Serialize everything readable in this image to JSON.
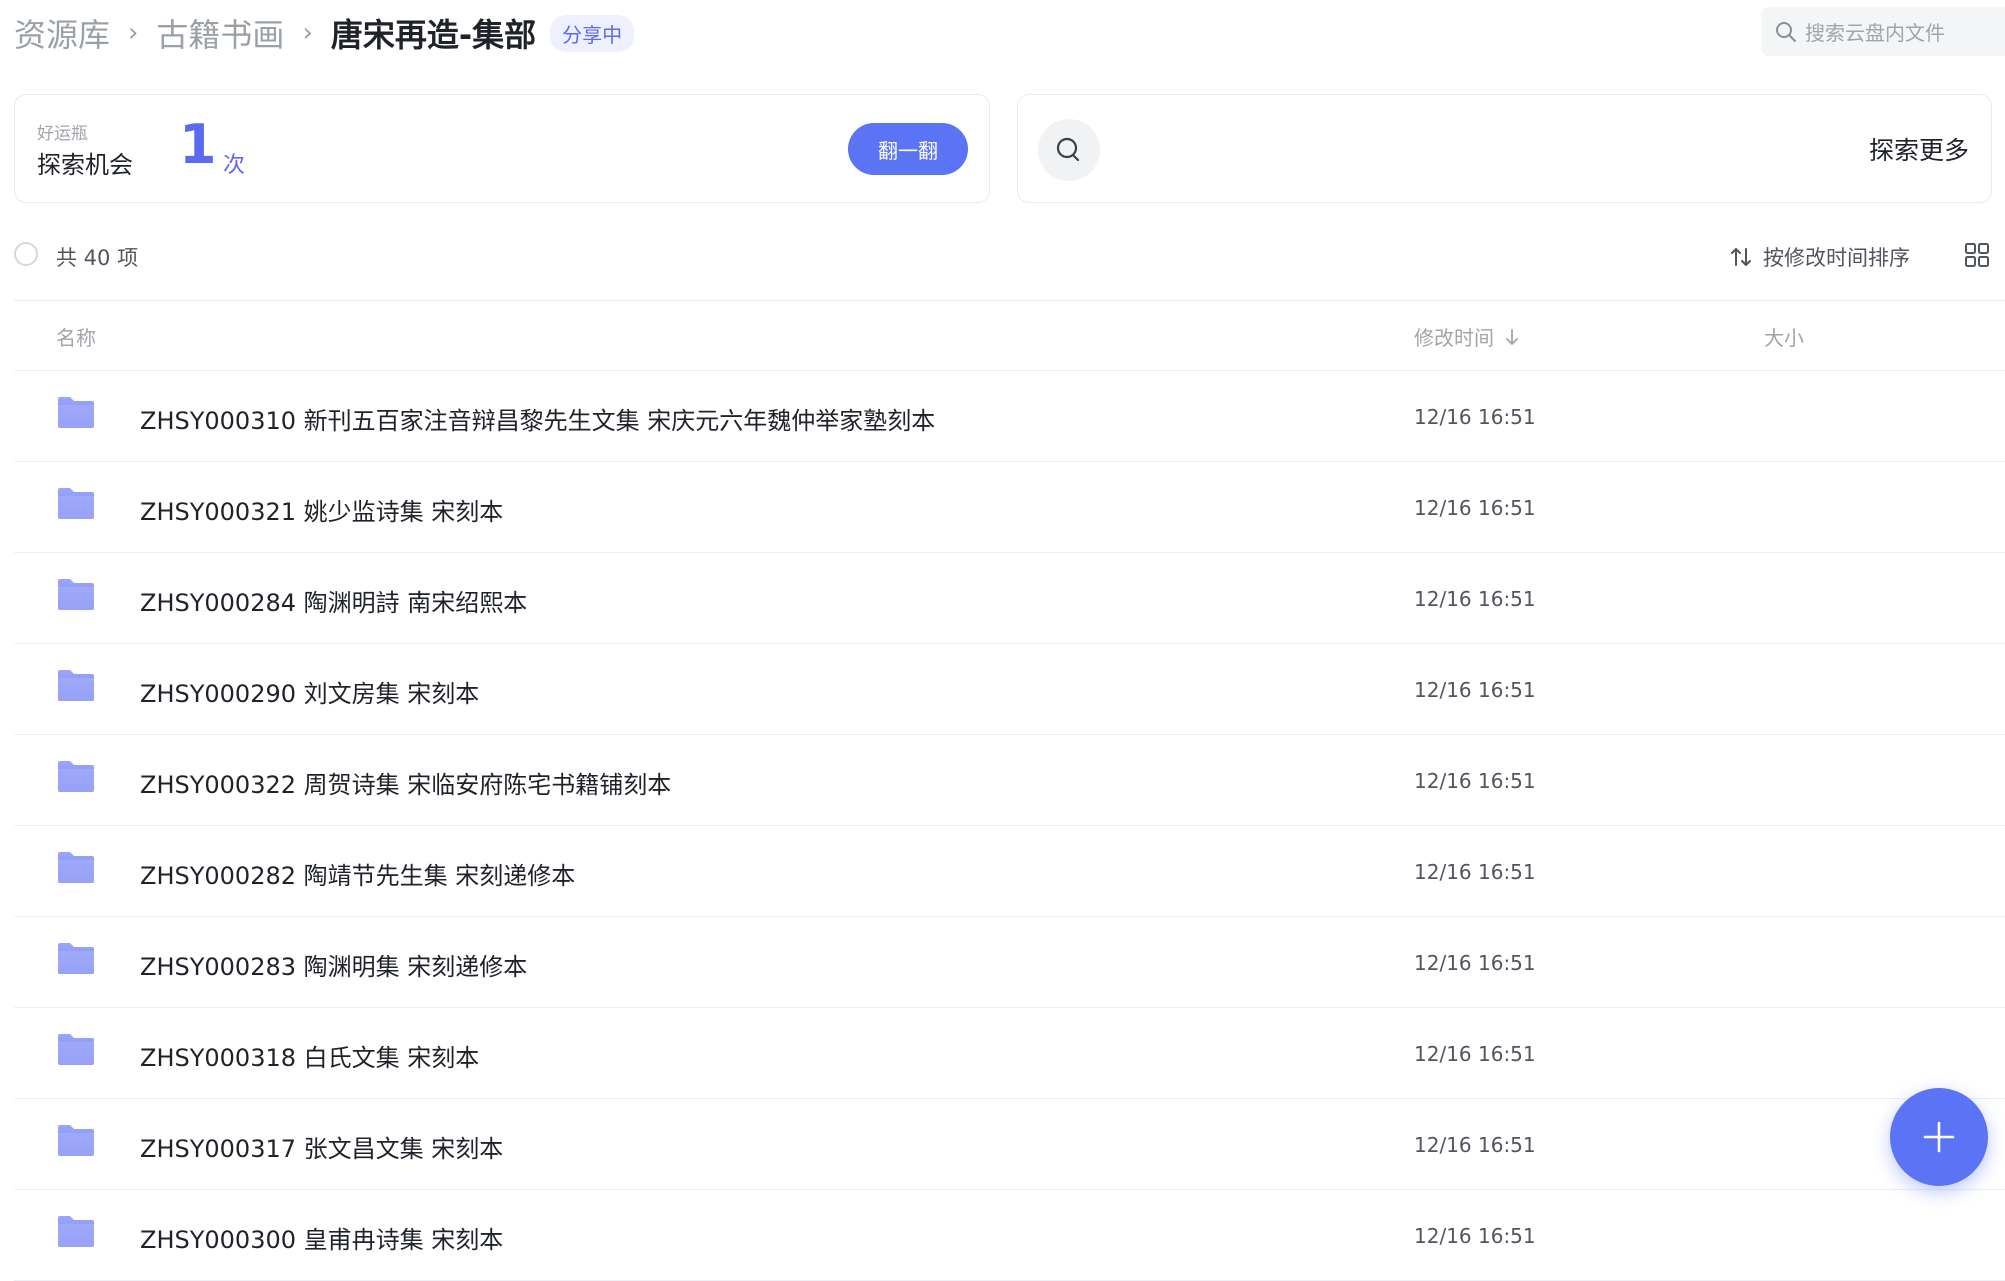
{
  "breadcrumb": {
    "items": [
      "资源库",
      "古籍书画"
    ],
    "current": "唐宋再造-集部",
    "badge": "分享中"
  },
  "search": {
    "placeholder": "搜索云盘内文件"
  },
  "luck_card": {
    "small_label": "好运瓶",
    "main_label": "探索机会",
    "count": "1",
    "unit": "次",
    "button": "翻一翻"
  },
  "explore_card": {
    "label": "探索更多"
  },
  "toolbar": {
    "count_label": "共 40 项",
    "sort_label": "按修改时间排序"
  },
  "table": {
    "headers": {
      "name": "名称",
      "time": "修改时间",
      "size": "大小"
    },
    "rows": [
      {
        "name": "ZHSY000310 新刊五百家注音辩昌黎先生文集 宋庆元六年魏仲举家塾刻本",
        "time": "12/16 16:51"
      },
      {
        "name": "ZHSY000321 姚少监诗集 宋刻本",
        "time": "12/16 16:51"
      },
      {
        "name": "ZHSY000284 陶渊明詩 南宋绍熙本",
        "time": "12/16 16:51"
      },
      {
        "name": "ZHSY000290 刘文房集 宋刻本",
        "time": "12/16 16:51"
      },
      {
        "name": "ZHSY000322 周贺诗集 宋临安府陈宅书籍铺刻本",
        "time": "12/16 16:51"
      },
      {
        "name": "ZHSY000282 陶靖节先生集 宋刻递修本",
        "time": "12/16 16:51"
      },
      {
        "name": "ZHSY000283 陶渊明集 宋刻递修本",
        "time": "12/16 16:51"
      },
      {
        "name": "ZHSY000318 白氏文集 宋刻本",
        "time": "12/16 16:51"
      },
      {
        "name": "ZHSY000317 张文昌文集 宋刻本",
        "time": "12/16 16:51"
      },
      {
        "name": "ZHSY000300 皇甫冉诗集 宋刻本",
        "time": "12/16 16:51"
      }
    ]
  },
  "colors": {
    "accent": "#5b73f5",
    "folder": "#8a95f5"
  }
}
